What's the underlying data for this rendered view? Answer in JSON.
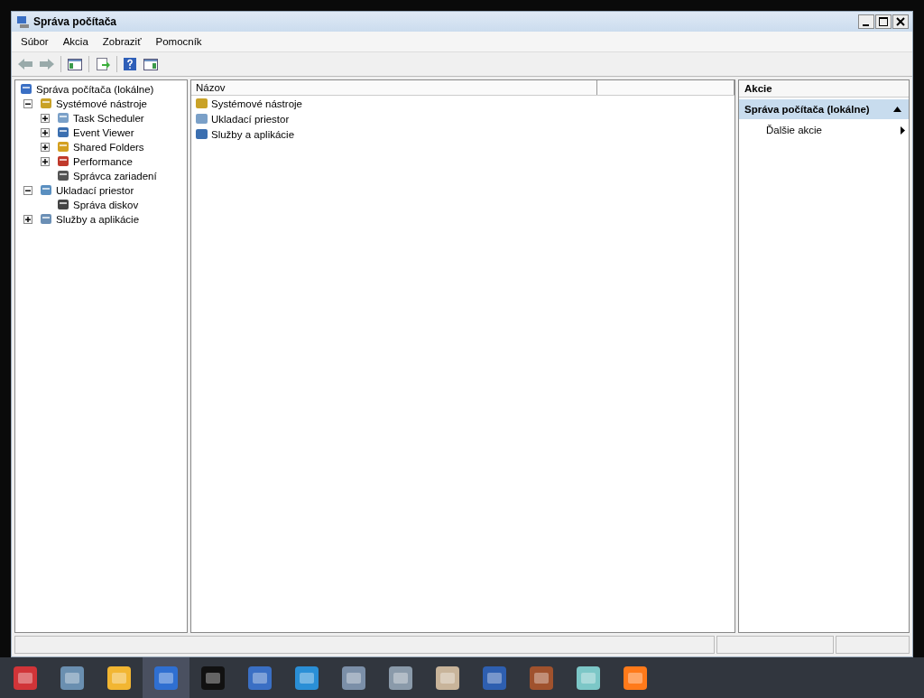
{
  "window": {
    "title": "Správa počítača"
  },
  "menu": [
    "Súbor",
    "Akcia",
    "Zobraziť",
    "Pomocník"
  ],
  "tree": [
    {
      "label": "Správa počítača (lokálne)",
      "kind": "root",
      "children": [
        {
          "label": "Systémové nástroje",
          "kind": "expandable",
          "expanded": true,
          "children": [
            {
              "label": "Task Scheduler",
              "kind": "expandable",
              "expanded": false
            },
            {
              "label": "Event Viewer",
              "kind": "expandable",
              "expanded": false
            },
            {
              "label": "Shared Folders",
              "kind": "expandable",
              "expanded": false
            },
            {
              "label": "Performance",
              "kind": "expandable",
              "expanded": false
            },
            {
              "label": "Správca zariadení",
              "kind": "leaf"
            }
          ]
        },
        {
          "label": "Ukladací priestor",
          "kind": "expandable",
          "expanded": true,
          "children": [
            {
              "label": "Správa diskov",
              "kind": "leaf"
            }
          ]
        },
        {
          "label": "Služby a aplikácie",
          "kind": "expandable",
          "expanded": false
        }
      ]
    }
  ],
  "list": {
    "columns": [
      "Názov"
    ],
    "rows": [
      "Systémové nástroje",
      "Ukladací priestor",
      "Služby a aplikácie"
    ]
  },
  "actions": {
    "title": "Akcie",
    "section": {
      "label": "Správa počítača (lokálne)",
      "expanded": true,
      "items": [
        "Ďalšie akcie"
      ]
    }
  },
  "taskbar": [
    {
      "selected": false
    },
    {
      "selected": false
    },
    {
      "selected": false
    },
    {
      "selected": true
    },
    {
      "selected": false
    },
    {
      "selected": false
    },
    {
      "selected": false
    },
    {
      "selected": false
    },
    {
      "selected": false
    },
    {
      "selected": false
    },
    {
      "selected": false
    },
    {
      "selected": false
    },
    {
      "selected": false
    },
    {
      "selected": false
    }
  ]
}
